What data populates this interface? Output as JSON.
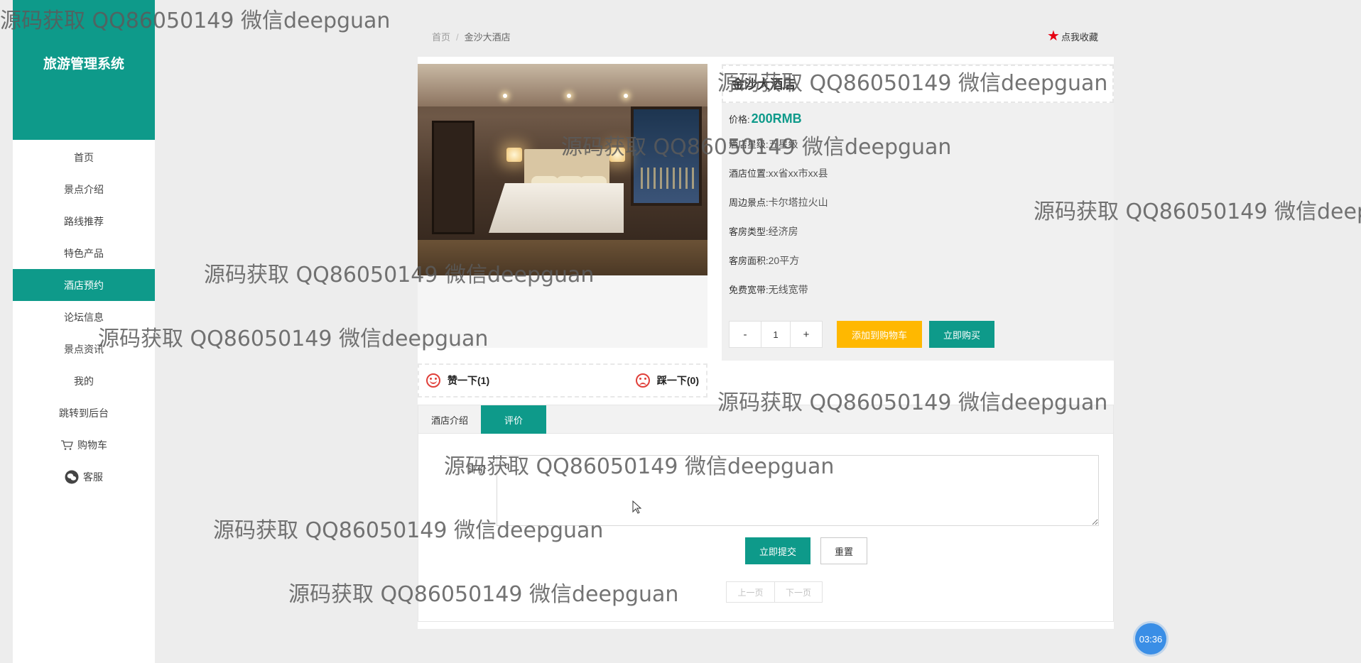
{
  "sidebar": {
    "logo": "旅游管理系统",
    "items": [
      {
        "label": "首页"
      },
      {
        "label": "景点介绍"
      },
      {
        "label": "路线推荐"
      },
      {
        "label": "特色产品"
      },
      {
        "label": "酒店预约"
      },
      {
        "label": "论坛信息"
      },
      {
        "label": "景点资讯"
      },
      {
        "label": "我的"
      },
      {
        "label": "跳转到后台"
      },
      {
        "label": "购物车",
        "icon": "cart-icon"
      },
      {
        "label": "客服",
        "icon": "wechat-icon"
      }
    ]
  },
  "breadcrumb": {
    "home": "首页",
    "sep": "/",
    "current": "金沙大酒店"
  },
  "favorite": {
    "label": "点我收藏",
    "icon": "star-icon"
  },
  "hotel": {
    "name": "金沙大酒店",
    "price_label": "价格:",
    "price": "200RMB",
    "attrs": [
      {
        "label": "酒店星级:",
        "value": "五星级"
      },
      {
        "label": "酒店位置:",
        "value": "xx省xx市xx县"
      },
      {
        "label": "周边景点:",
        "value": "卡尔塔拉火山"
      },
      {
        "label": "客房类型:",
        "value": "经济房"
      },
      {
        "label": "客房面积:",
        "value": "20平方"
      },
      {
        "label": "免费宽带:",
        "value": "无线宽带"
      }
    ]
  },
  "purchase": {
    "minus": "-",
    "quantity": "1",
    "plus": "+",
    "add_cart": "添加到购物车",
    "buy_now": "立即购买"
  },
  "votes": {
    "up": "赞一下(1)",
    "down": "踩一下(0)"
  },
  "tabs": [
    {
      "label": "酒店介绍"
    },
    {
      "label": "评价"
    }
  ],
  "comment": {
    "label": "评价",
    "value": "q",
    "submit": "立即提交",
    "reset": "重置"
  },
  "pager": {
    "prev": "上一页",
    "next": "下一页"
  },
  "timer": "03:36",
  "watermark": "源码获取 QQ86050149 微信deepguan",
  "colors": {
    "accent": "#0e9a8a",
    "cart_button": "#ffb800",
    "price": "#0e9a8a",
    "star": "#e60012",
    "timer": "#3a8ee6"
  }
}
